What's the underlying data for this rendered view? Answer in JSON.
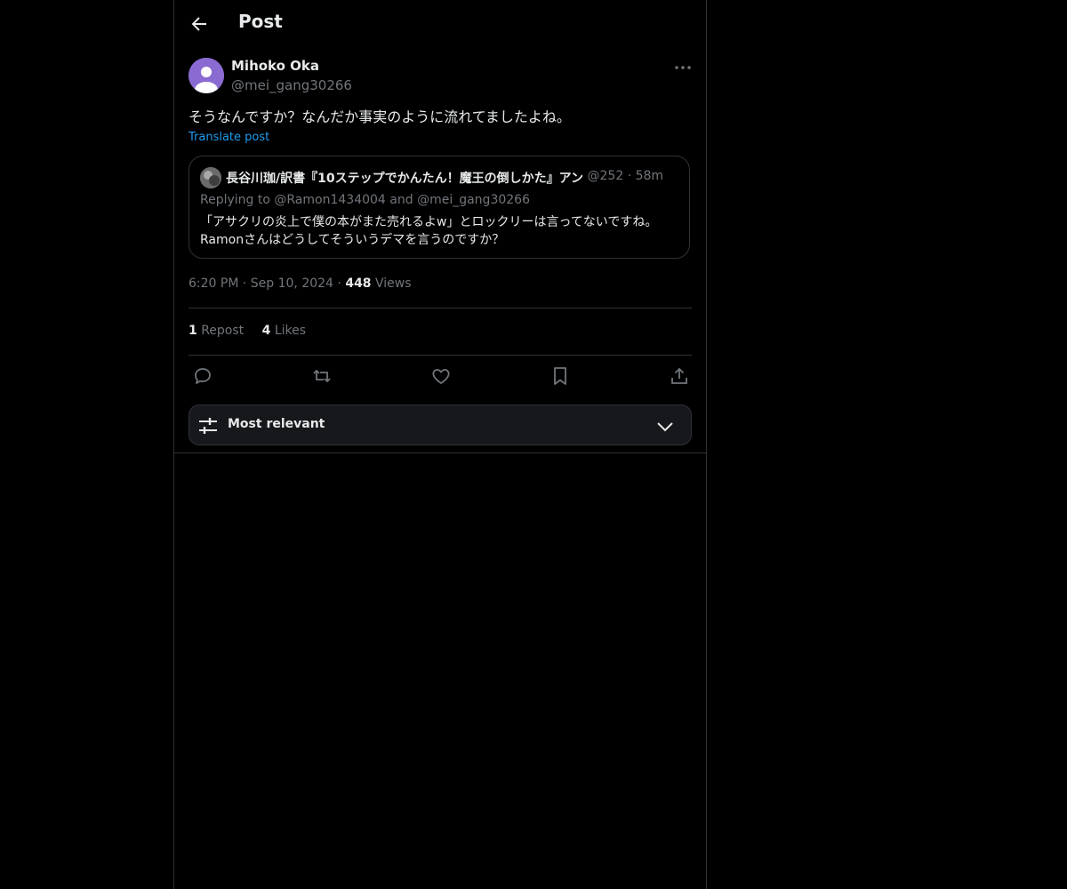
{
  "header": {
    "title": "Post",
    "back_icon": "arrow-left-icon"
  },
  "post": {
    "author": {
      "name": "Mihoko Oka",
      "handle": "@mei_gang30266",
      "avatar_color": "#8a6bd1"
    },
    "text": "そうなんですか？なんだか事実のように流れてましたよね。",
    "translate_label": "Translate post",
    "quote": {
      "author_name": "長谷川珈/訳書『10ステップでかんたん！魔王の倒しかた』アン",
      "author_handle": "@252",
      "dot": "·",
      "time": "58m",
      "replying_prefix": "Replying to",
      "reply_mention_1": "@Ramon1434004",
      "reply_and": "and",
      "reply_mention_2": "@mei_gang30266",
      "text": "「アサクリの炎上で僕の本がまた売れるよw」とロックリーは言ってないですね。Ramonさんはどうしてそういうデマを言うのですか？"
    },
    "time": "6:20 PM",
    "dot": "·",
    "date": "Sep 10, 2024",
    "views_count": "448",
    "views_label": "Views",
    "reposts_count": "1",
    "reposts_label": "Repost",
    "likes_count": "4",
    "likes_label": "Likes"
  },
  "actions": [
    "reply-icon",
    "repost-icon",
    "like-icon",
    "bookmark-icon",
    "share-icon"
  ],
  "sort": {
    "label": "Most relevant",
    "icon": "sliders-icon",
    "chevron": "chevron-down-icon"
  },
  "colors": {
    "background": "#000000",
    "accent": "#1d9bf0",
    "muted": "#71767b",
    "border": "#2f3336"
  }
}
